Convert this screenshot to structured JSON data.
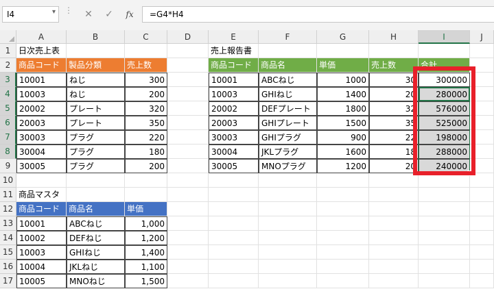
{
  "namebox": "I4",
  "formula": "=G4*H4",
  "colors": {
    "orange": "#ed7d31",
    "green": "#70ad47",
    "blue": "#4472c4",
    "excel_green": "#217346",
    "highlight_red": "#e8202a"
  },
  "icons": [
    "cancel-icon",
    "enter-check-icon",
    "function-fx-icon",
    "dropdown-caret-icon"
  ],
  "columns": [
    "A",
    "B",
    "C",
    "D",
    "E",
    "F",
    "G",
    "H",
    "I",
    "J"
  ],
  "rows": [
    "1",
    "2",
    "3",
    "4",
    "5",
    "6",
    "7",
    "8",
    "9",
    "10",
    "11",
    "12",
    "13",
    "14",
    "15",
    "16",
    "17"
  ],
  "daily": {
    "title": "日次売上表",
    "headers": [
      "商品コード",
      "製品分類",
      "売上数"
    ],
    "rows": [
      [
        "10001",
        "ねじ",
        "300"
      ],
      [
        "10003",
        "ねじ",
        "200"
      ],
      [
        "20002",
        "プレート",
        "320"
      ],
      [
        "20003",
        "プレート",
        "350"
      ],
      [
        "30003",
        "プラグ",
        "220"
      ],
      [
        "30004",
        "プラグ",
        "180"
      ],
      [
        "30005",
        "プラグ",
        "200"
      ]
    ]
  },
  "report": {
    "title": "売上報告書",
    "headers": [
      "商品コード",
      "商品名",
      "単価",
      "売上数",
      "合計"
    ],
    "rows": [
      [
        "10001",
        "ABCねじ",
        "1000",
        "30",
        "300000"
      ],
      [
        "10003",
        "GHIねじ",
        "1400",
        "20",
        "280000"
      ],
      [
        "20002",
        "DEFプレート",
        "1800",
        "32",
        "576000"
      ],
      [
        "20003",
        "GHIプレート",
        "1500",
        "35",
        "525000"
      ],
      [
        "30003",
        "GHIプラグ",
        "900",
        "22",
        "198000"
      ],
      [
        "30004",
        "JKLプラグ",
        "1600",
        "18",
        "288000"
      ],
      [
        "30005",
        "MNOプラグ",
        "1200",
        "20",
        "240000"
      ]
    ]
  },
  "master": {
    "title": "商品マスタ",
    "headers": [
      "商品コード",
      "商品名",
      "単価"
    ],
    "rows": [
      [
        "10001",
        "ABCねじ",
        "1,000"
      ],
      [
        "10002",
        "DEFねじ",
        "1,200"
      ],
      [
        "10003",
        "GHIねじ",
        "1,400"
      ],
      [
        "10004",
        "JKLねじ",
        "1,100"
      ],
      [
        "10005",
        "MNOねじ",
        "1,500"
      ]
    ]
  }
}
